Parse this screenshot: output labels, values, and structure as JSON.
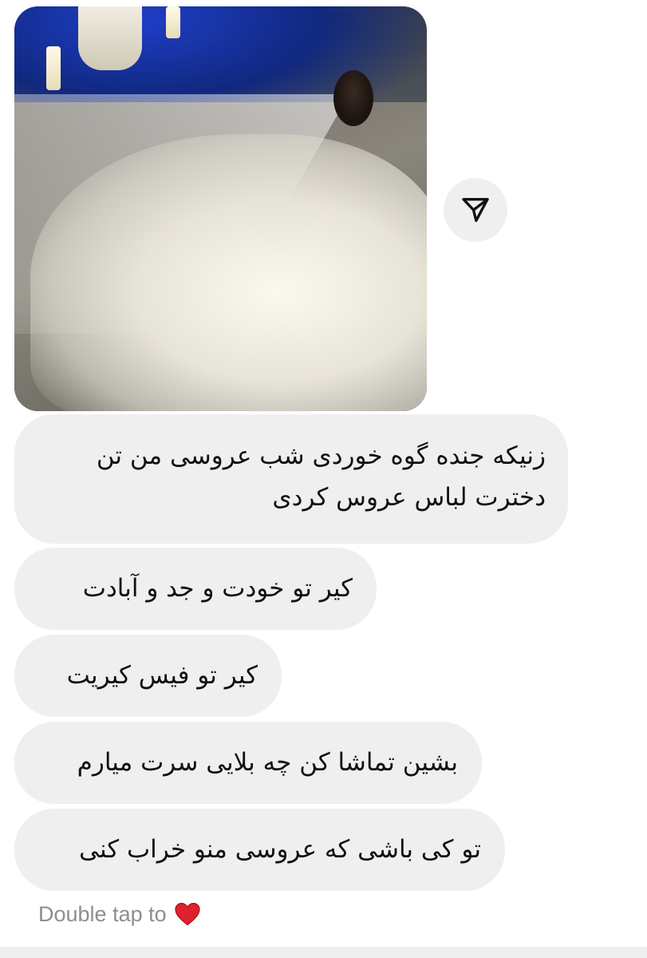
{
  "messages": [
    {
      "text": "زنیکه جنده گوه خوردی شب عروسی من تن دخترت لباس عروس کردی"
    },
    {
      "text": "کیر تو خودت و جد و آبادت"
    },
    {
      "text": "کیر تو فیس کیریت"
    },
    {
      "text": "بشین تماشا کن چه بلایی سرت میارم"
    },
    {
      "text": "تو کی باشی که عروسی منو خراب کنی"
    }
  ],
  "hint": {
    "text": "Double tap to",
    "icon": "heart-icon",
    "icon_color": "#e0202d"
  },
  "photo": {
    "icon": "share-icon"
  },
  "colors": {
    "bubble_bg": "#efefef",
    "hint_text": "#8e8e8e"
  }
}
